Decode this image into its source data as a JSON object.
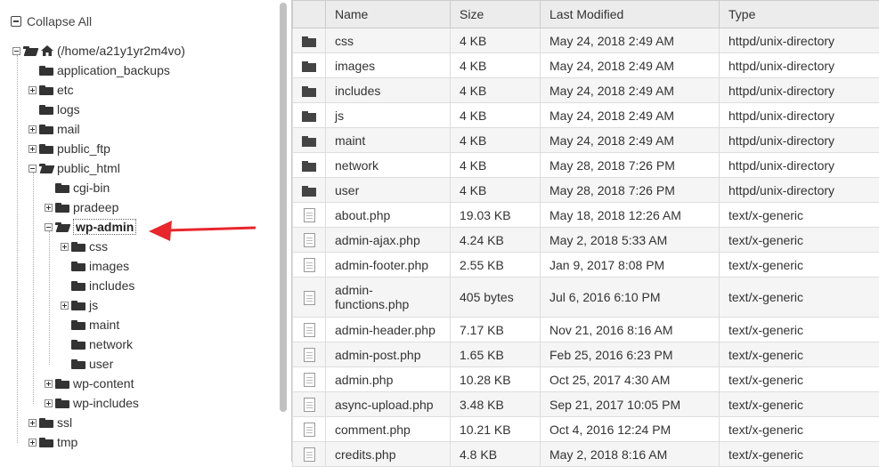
{
  "tree": {
    "collapse_label": "Collapse All",
    "root_label": "(/home/a21y1yr2m4vo)",
    "items": [
      {
        "label": "application_backups"
      },
      {
        "label": "etc"
      },
      {
        "label": "logs"
      },
      {
        "label": "mail"
      },
      {
        "label": "public_ftp"
      },
      {
        "label": "public_html"
      },
      {
        "label": "cgi-bin"
      },
      {
        "label": "pradeep"
      },
      {
        "label": "wp-admin"
      },
      {
        "label": "css"
      },
      {
        "label": "images"
      },
      {
        "label": "includes"
      },
      {
        "label": "js"
      },
      {
        "label": "maint"
      },
      {
        "label": "network"
      },
      {
        "label": "user"
      },
      {
        "label": "wp-content"
      },
      {
        "label": "wp-includes"
      },
      {
        "label": "ssl"
      },
      {
        "label": "tmp"
      }
    ]
  },
  "table": {
    "headers": {
      "name": "Name",
      "size": "Size",
      "modified": "Last Modified",
      "type": "Type"
    },
    "rows": [
      {
        "name": "css",
        "size": "4 KB",
        "modified": "May 24, 2018 2:49 AM",
        "type": "httpd/unix-directory"
      },
      {
        "name": "images",
        "size": "4 KB",
        "modified": "May 24, 2018 2:49 AM",
        "type": "httpd/unix-directory"
      },
      {
        "name": "includes",
        "size": "4 KB",
        "modified": "May 24, 2018 2:49 AM",
        "type": "httpd/unix-directory"
      },
      {
        "name": "js",
        "size": "4 KB",
        "modified": "May 24, 2018 2:49 AM",
        "type": "httpd/unix-directory"
      },
      {
        "name": "maint",
        "size": "4 KB",
        "modified": "May 24, 2018 2:49 AM",
        "type": "httpd/unix-directory"
      },
      {
        "name": "network",
        "size": "4 KB",
        "modified": "May 28, 2018 7:26 PM",
        "type": "httpd/unix-directory"
      },
      {
        "name": "user",
        "size": "4 KB",
        "modified": "May 28, 2018 7:26 PM",
        "type": "httpd/unix-directory"
      },
      {
        "name": "about.php",
        "size": "19.03 KB",
        "modified": "May 18, 2018 12:26 AM",
        "type": "text/x-generic"
      },
      {
        "name": "admin-ajax.php",
        "size": "4.24 KB",
        "modified": "May 2, 2018 5:33 AM",
        "type": "text/x-generic"
      },
      {
        "name": "admin-footer.php",
        "size": "2.55 KB",
        "modified": "Jan 9, 2017 8:08 PM",
        "type": "text/x-generic"
      },
      {
        "name": "admin-\nfunctions.php",
        "size": "405 bytes",
        "modified": "Jul 6, 2016 6:10 PM",
        "type": "text/x-generic"
      },
      {
        "name": "admin-header.php",
        "size": "7.17 KB",
        "modified": "Nov 21, 2016 8:16 AM",
        "type": "text/x-generic"
      },
      {
        "name": "admin-post.php",
        "size": "1.65 KB",
        "modified": "Feb 25, 2016 6:23 PM",
        "type": "text/x-generic"
      },
      {
        "name": "admin.php",
        "size": "10.28 KB",
        "modified": "Oct 25, 2017 4:30 AM",
        "type": "text/x-generic"
      },
      {
        "name": "async-upload.php",
        "size": "3.48 KB",
        "modified": "Sep 21, 2017 10:05 PM",
        "type": "text/x-generic"
      },
      {
        "name": "comment.php",
        "size": "10.21 KB",
        "modified": "Oct 4, 2016 12:24 PM",
        "type": "text/x-generic"
      },
      {
        "name": "credits.php",
        "size": "4.8 KB",
        "modified": "May 2, 2018 8:16 AM",
        "type": "text/x-generic"
      }
    ]
  },
  "colors": {
    "arrow": "#e8262c"
  }
}
